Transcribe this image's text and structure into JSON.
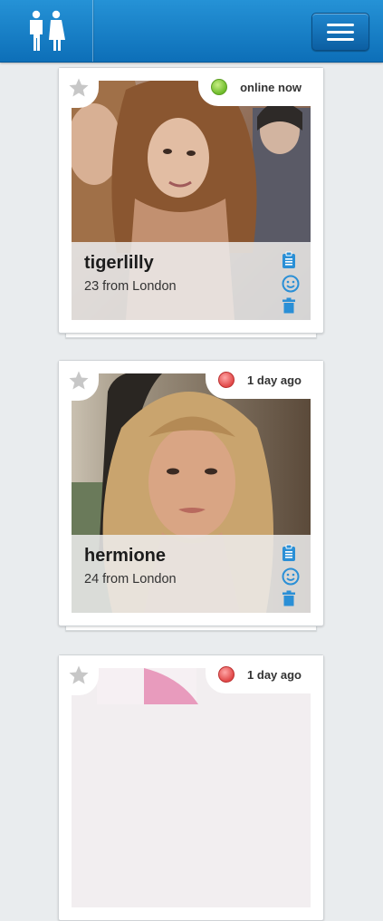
{
  "header": {
    "logo_icon": "couple-icon",
    "menu_icon": "hamburger-menu-icon",
    "brand_color": "#1180c6"
  },
  "profiles": [
    {
      "username": "tigerlilly",
      "subline": "23 from London",
      "status": "online now",
      "status_color": "green"
    },
    {
      "username": "hermione",
      "subline": "24 from London",
      "status": "1 day ago",
      "status_color": "red"
    },
    {
      "username": "",
      "subline": "",
      "status": "1 day ago",
      "status_color": "red"
    }
  ],
  "actions": [
    "clipboard-icon",
    "smiley-icon",
    "trash-icon"
  ]
}
